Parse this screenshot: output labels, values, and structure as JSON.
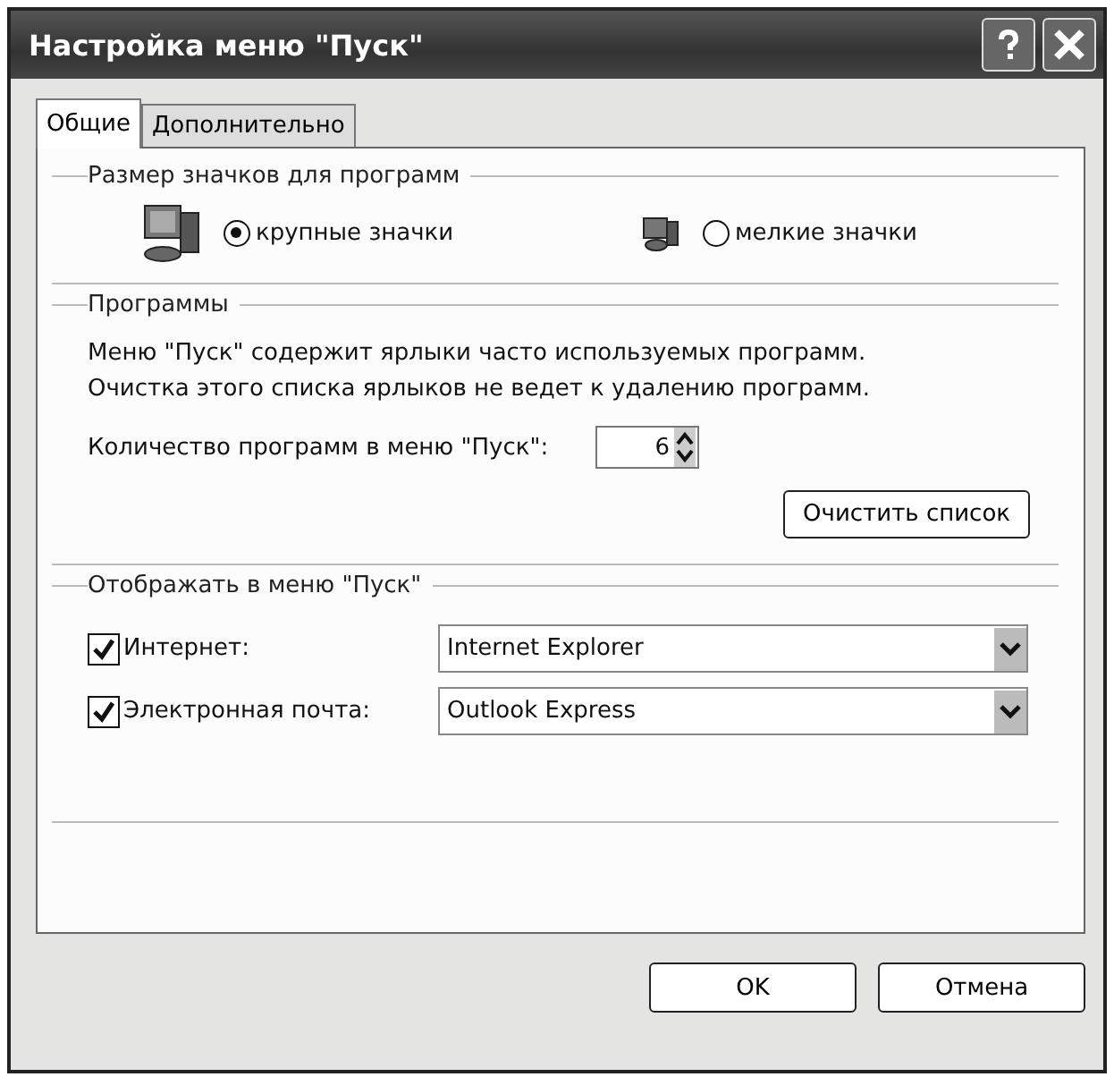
{
  "window": {
    "title": "Настройка меню \"Пуск\""
  },
  "tabs": [
    {
      "label": "Общие",
      "selected": true
    },
    {
      "label": "Дополнительно",
      "selected": false
    }
  ],
  "icon_size": {
    "title": "Размер значков для программ",
    "options": [
      {
        "label": "крупные значки",
        "selected": true,
        "kind": "large"
      },
      {
        "label": "мелкие значки",
        "selected": false,
        "kind": "small"
      }
    ]
  },
  "programs": {
    "title": "Программы",
    "description": [
      "Меню \"Пуск\" содержит ярлыки часто используемых программ.",
      "Очистка этого списка ярлыков не ведет к удалению программ."
    ],
    "count_label": "Количество программ в меню \"Пуск\":",
    "count_value": "6",
    "clear_button": "Очистить список"
  },
  "show": {
    "title": "Отображать в меню \"Пуск\"",
    "items": [
      {
        "label": "Интернет:",
        "checked": true,
        "value": "Internet Explorer"
      },
      {
        "label": "Электронная почта:",
        "checked": true,
        "value": "Outlook Express"
      }
    ]
  },
  "buttons": [
    "OK",
    "Отмена"
  ]
}
